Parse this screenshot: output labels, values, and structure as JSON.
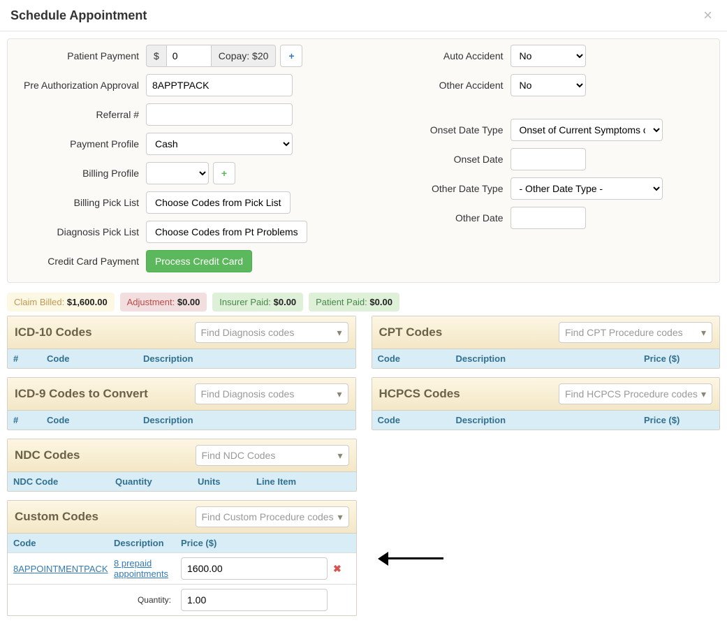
{
  "modal": {
    "title": "Schedule Appointment"
  },
  "left_form": {
    "patient_payment_label": "Patient Payment",
    "currency": "$",
    "patient_payment_value": "0",
    "copay_text": "Copay: $20",
    "pre_auth_label": "Pre Authorization Approval",
    "pre_auth_value": "8APPTPACK",
    "referral_label": "Referral #",
    "referral_value": "",
    "payment_profile_label": "Payment Profile",
    "payment_profile_value": "Cash",
    "billing_profile_label": "Billing Profile",
    "billing_profile_value": "",
    "billing_picklist_label": "Billing Pick List",
    "billing_picklist_btn": "Choose Codes from Pick List",
    "diag_picklist_label": "Diagnosis Pick List",
    "diag_picklist_btn": "Choose Codes from Pt Problems",
    "cc_payment_label": "Credit Card Payment",
    "cc_payment_btn": "Process Credit Card"
  },
  "right_form": {
    "auto_accident_label": "Auto Accident",
    "auto_accident_value": "No",
    "other_accident_label": "Other Accident",
    "other_accident_value": "No",
    "onset_type_label": "Onset Date Type",
    "onset_type_value": "Onset of Current Symptoms o",
    "onset_date_label": "Onset Date",
    "onset_date_value": "",
    "other_type_label": "Other Date Type",
    "other_type_value": "- Other Date Type -",
    "other_date_label": "Other Date",
    "other_date_value": ""
  },
  "badges": {
    "billed_label": "Claim Billed: ",
    "billed_value": "$1,600.00",
    "adj_label": "Adjustment: ",
    "adj_value": "$0.00",
    "ins_label": "Insurer Paid: ",
    "ins_value": "$0.00",
    "pat_label": "Patient Paid: ",
    "pat_value": "$0.00"
  },
  "panels": {
    "icd10_title": "ICD-10 Codes",
    "icd10_placeholder": "Find Diagnosis codes",
    "icd9_title": "ICD-9 Codes to Convert",
    "icd9_placeholder": "Find Diagnosis codes",
    "ndc_title": "NDC Codes",
    "ndc_placeholder": "Find NDC Codes",
    "custom_title": "Custom Codes",
    "custom_placeholder": "Find Custom Procedure codes",
    "cpt_title": "CPT Codes",
    "cpt_placeholder": "Find CPT Procedure codes",
    "hcpcs_title": "HCPCS Codes",
    "hcpcs_placeholder": "Find HCPCS Procedure codes"
  },
  "cols": {
    "hash": "#",
    "code": "Code",
    "desc": "Description",
    "price": "Price ($)",
    "ndc_code": "NDC Code",
    "qty": "Quantity",
    "units": "Units",
    "line": "Line Item"
  },
  "custom_row": {
    "code": "8APPOINTMENTPACK",
    "desc": "8 prepaid appointments",
    "price": "1600.00",
    "qty_label": "Quantity:",
    "qty_value": "1.00"
  }
}
